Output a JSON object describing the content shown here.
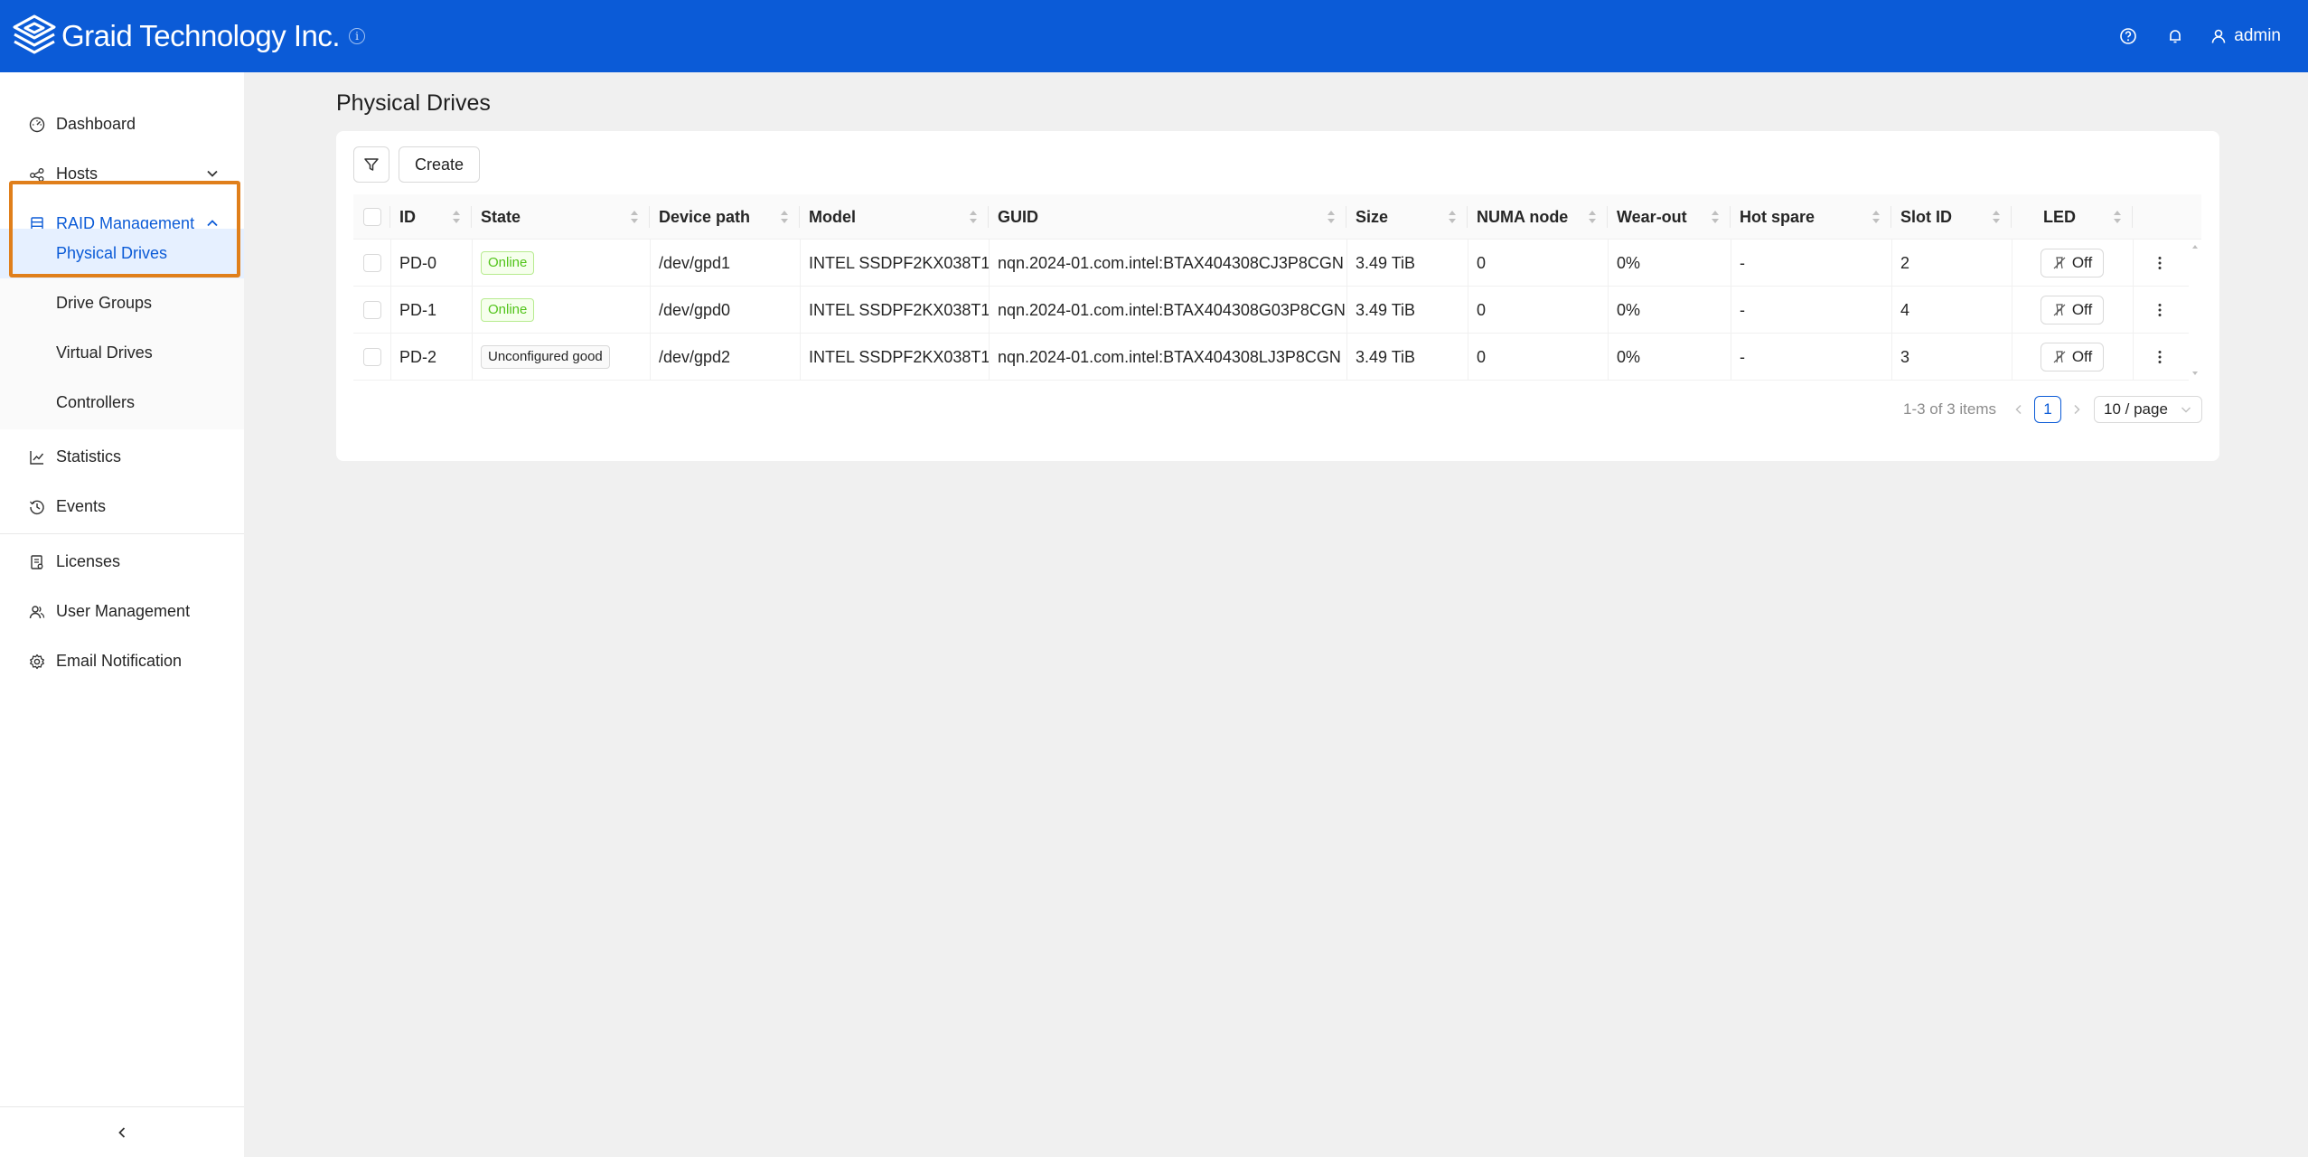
{
  "header": {
    "brand": "Graid Technology Inc.",
    "info_glyph": "i",
    "user": "admin",
    "icons": [
      "help-icon",
      "bell-icon",
      "user-icon"
    ]
  },
  "sidebar": {
    "items": [
      {
        "label": "Dashboard",
        "icon": "dashboard-icon"
      },
      {
        "label": "Hosts",
        "icon": "hosts-icon"
      },
      {
        "label": "RAID Management",
        "icon": "raid-icon"
      },
      {
        "label": "Statistics",
        "icon": "chart-icon"
      },
      {
        "label": "Events",
        "icon": "history-icon"
      },
      {
        "label": "Licenses",
        "icon": "license-icon"
      },
      {
        "label": "User Management",
        "icon": "users-icon"
      },
      {
        "label": "Email Notification",
        "icon": "gear-icon"
      }
    ],
    "raid_sub": [
      "Physical Drives",
      "Drive Groups",
      "Virtual Drives",
      "Controllers"
    ],
    "active": "Physical Drives",
    "highlight_color": "#e07f1b"
  },
  "main": {
    "title": "Physical Drives",
    "create_label": "Create"
  },
  "table": {
    "columns": [
      "ID",
      "State",
      "Device path",
      "Model",
      "GUID",
      "Size",
      "NUMA node",
      "Wear-out",
      "Hot spare",
      "Slot ID",
      "LED"
    ],
    "rows": [
      {
        "id": "PD-0",
        "state": "Online",
        "path": "/dev/gpd1",
        "model": "INTEL SSDPF2KX038T1",
        "guid": "nqn.2024-01.com.intel:BTAX404308CJ3P8CGN",
        "size": "3.49 TiB",
        "numa": "0",
        "wear": "0%",
        "hot": "-",
        "slot": "2",
        "led": "Off"
      },
      {
        "id": "PD-1",
        "state": "Online",
        "path": "/dev/gpd0",
        "model": "INTEL SSDPF2KX038T1",
        "guid": "nqn.2024-01.com.intel:BTAX404308G03P8CGN",
        "size": "3.49 TiB",
        "numa": "0",
        "wear": "0%",
        "hot": "-",
        "slot": "4",
        "led": "Off"
      },
      {
        "id": "PD-2",
        "state": "Unconfigured good",
        "path": "/dev/gpd2",
        "model": "INTEL SSDPF2KX038T1",
        "guid": "nqn.2024-01.com.intel:BTAX404308LJ3P8CGN",
        "size": "3.49 TiB",
        "numa": "0",
        "wear": "0%",
        "hot": "-",
        "slot": "3",
        "led": "Off"
      }
    ]
  },
  "pagination": {
    "summary": "1-3 of 3 items",
    "current": "1",
    "page_size": "10 / page"
  },
  "colors": {
    "primary": "#0b5bd7",
    "online": "#52c41a"
  }
}
